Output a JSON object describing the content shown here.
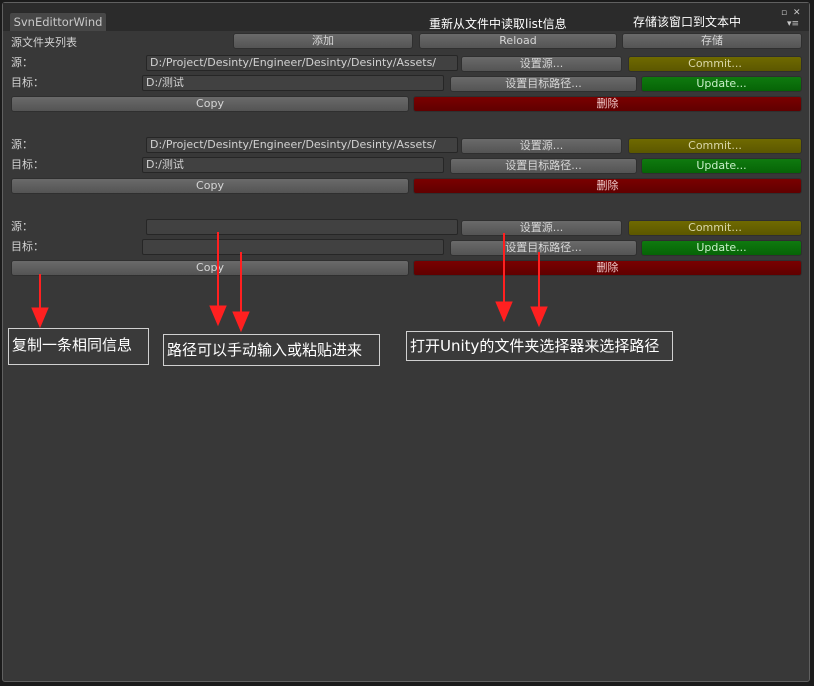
{
  "window": {
    "tab_title": "SvnEdittorWind",
    "annotations_top": {
      "reload_note": "重新从文件中读取list信息",
      "save_note": "存储该窗口到文本中"
    },
    "icons": [
      "restore-icon",
      "close-icon",
      "menu-icon"
    ]
  },
  "header": {
    "list_title": "源文件夹列表",
    "add_button": "添加",
    "reload_button": "Reload",
    "save_button": "存储"
  },
  "entries": [
    {
      "source_label": "源：",
      "source_value": "D:/Project/Desinty/Engineer/Desinty/Desinty/Assets/",
      "set_source_button": "设置源...",
      "commit_button": "Commit...",
      "target_label": "目标：",
      "target_value": "D:/测试",
      "set_target_button": "设置目标路径...",
      "update_button": "Update...",
      "copy_button": "Copy",
      "delete_button": "删除"
    },
    {
      "source_label": "源：",
      "source_value": "D:/Project/Desinty/Engineer/Desinty/Desinty/Assets/",
      "set_source_button": "设置源...",
      "commit_button": "Commit...",
      "target_label": "目标：",
      "target_value": "D:/测试",
      "set_target_button": "设置目标路径...",
      "update_button": "Update...",
      "copy_button": "Copy",
      "delete_button": "删除"
    },
    {
      "source_label": "源：",
      "source_value": "",
      "set_source_button": "设置源...",
      "commit_button": "Commit...",
      "target_label": "目标：",
      "target_value": "",
      "set_target_button": "设置目标路径...",
      "update_button": "Update...",
      "copy_button": "Copy",
      "delete_button": "删除"
    }
  ],
  "annotations": {
    "copy_note": "复制一条相同信息",
    "path_note": "路径可以手动输入或粘贴进来",
    "picker_note": "打开Unity的文件夹选择器来选择路径"
  },
  "colors": {
    "arrow": "#ff2020",
    "commit": "#6f6a00",
    "update": "#0f7a0f",
    "delete": "#7a0000"
  }
}
